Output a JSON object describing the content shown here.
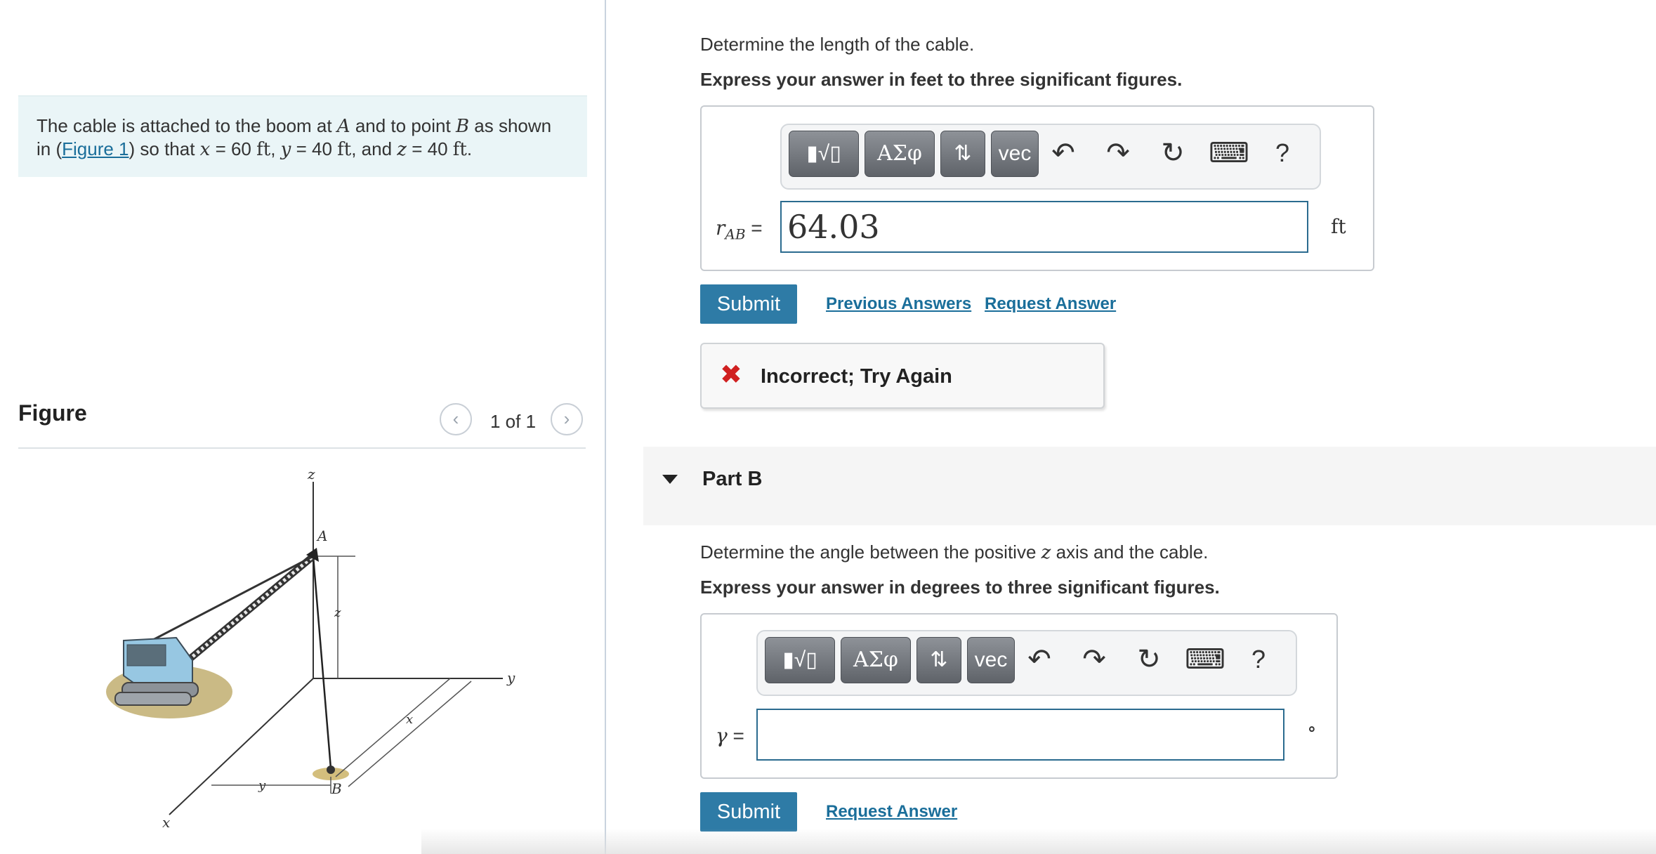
{
  "problem": {
    "text_1": "The cable is attached to the boom at ",
    "var_A": "A",
    "text_2": " and to point ",
    "var_B": "B",
    "text_3": " as shown",
    "text_4": "in (",
    "figure_link": "Figure 1",
    "text_5": ") so that ",
    "var_x": "x",
    "eq_x": " = 60 ",
    "unit_x": "ft",
    "comma_1": ", ",
    "var_y": "y",
    "eq_y": " = 40 ",
    "unit_y": "ft",
    "comma_2": ", and ",
    "var_z": "z",
    "eq_z": " = 40 ",
    "unit_z": "ft",
    "period": "."
  },
  "figure": {
    "title": "Figure",
    "counter": "1 of 1",
    "prev_icon": "chevron-left-icon",
    "next_icon": "chevron-right-icon",
    "labels": {
      "z_axis": "z",
      "y_axis": "y",
      "x_axis": "x",
      "A": "A",
      "B": "B",
      "z_dim": "z",
      "x_dim": "x",
      "y_dim": "y"
    }
  },
  "part_a": {
    "question": "Determine the length of the cable.",
    "instruction": "Express your answer in feet to three significant figures.",
    "toolbar": {
      "templates": "templates-icon",
      "greek": "ΑΣφ",
      "arrows": "⇅",
      "vec": "vec",
      "help": "?"
    },
    "var_main": "r",
    "var_sub": "AB",
    "equals": " =",
    "input_value": "64.03",
    "unit": "ft",
    "submit_label": "Submit",
    "previous_answers": "Previous Answers",
    "request_answer": "Request Answer",
    "feedback": "Incorrect; Try Again",
    "feedback_icon": "x-icon",
    "feedback_color": "#d02020"
  },
  "part_b": {
    "title": "Part B",
    "question_1": "Determine the angle between the positive ",
    "question_var": "z",
    "question_2": " axis and the cable.",
    "instruction": "Express your answer in degrees to three significant figures.",
    "toolbar": {
      "templates": "templates-icon",
      "greek": "ΑΣφ",
      "arrows": "⇅",
      "vec": "vec",
      "help": "?"
    },
    "var_main": "γ",
    "equals": " =",
    "input_value": "",
    "unit": "∘",
    "submit_label": "Submit",
    "request_answer": "Request Answer"
  },
  "colors": {
    "accent": "#2e7ba6",
    "link": "#1a6e9a",
    "problem_bg": "#eaf5f7"
  }
}
